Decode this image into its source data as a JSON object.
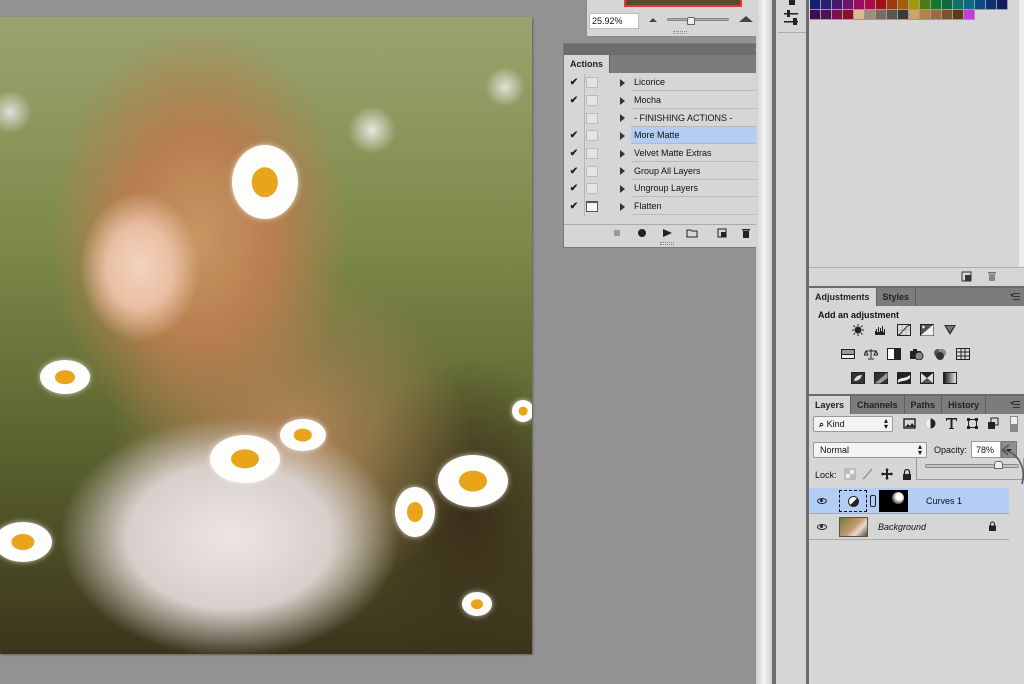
{
  "navigator": {
    "zoom_value": "25.92%",
    "zoom_slider_fraction": 0.45
  },
  "actions_panel": {
    "tab_label": "Actions",
    "items": [
      {
        "name": "Licorice",
        "checked": true,
        "dialog": false,
        "selected": false
      },
      {
        "name": "Mocha",
        "checked": true,
        "dialog": false,
        "selected": false
      },
      {
        "name": "- FINISHING ACTIONS -",
        "checked": false,
        "dialog": false,
        "selected": false
      },
      {
        "name": "More Matte",
        "checked": true,
        "dialog": false,
        "selected": true
      },
      {
        "name": "Velvet Matte Extras",
        "checked": true,
        "dialog": false,
        "selected": false
      },
      {
        "name": "Group All Layers",
        "checked": true,
        "dialog": false,
        "selected": false
      },
      {
        "name": "Ungroup Layers",
        "checked": true,
        "dialog": false,
        "selected": false
      },
      {
        "name": "Flatten",
        "checked": true,
        "dialog": true,
        "selected": false
      }
    ],
    "footer_buttons": [
      "stop-icon",
      "record-icon",
      "play-icon",
      "new-set-folder-icon",
      "new-action-icon",
      "trash-icon"
    ],
    "check_glyph": "✔"
  },
  "swatches": {
    "row1": [
      "#14206e",
      "#2a1c6e",
      "#48176e",
      "#6a146c",
      "#9c0a5f",
      "#b0094a",
      "#a30e19",
      "#9b3b0a",
      "#a35e0a",
      "#a39a0a",
      "#4d7b19",
      "#0f7a2e",
      "#0f6b3e",
      "#0d7164",
      "#0d6a86",
      "#0c4a86",
      "#0e3070",
      "#0e1e62"
    ],
    "row2": [
      "#3b0d54",
      "#560f55",
      "#7b0e4f",
      "#8a0d2a",
      "#d9b990",
      "#a08e7c",
      "#7c6a5e",
      "#5c544f",
      "#3e3a38",
      "#d2a06a",
      "#b68252",
      "#9d6b3e",
      "#7f5328",
      "#5f3a14",
      "#c53bd9"
    ]
  },
  "adjustments_panel": {
    "tabs": [
      "Adjustments",
      "Styles"
    ],
    "active_tab": "Adjustments",
    "heading": "Add an adjustment",
    "row1_icons": [
      "brightness-contrast-icon",
      "levels-icon",
      "curves-icon",
      "exposure-icon",
      "vibrance-icon"
    ],
    "row2_icons": [
      "hue-saturation-icon",
      "color-balance-icon",
      "black-white-icon",
      "photo-filter-icon",
      "channel-mixer-icon",
      "color-lookup-icon"
    ],
    "row3_icons": [
      "invert-icon",
      "posterize-icon",
      "threshold-icon",
      "selective-color-icon",
      "gradient-map-icon"
    ]
  },
  "layers_panel": {
    "tabs": [
      "Layers",
      "Channels",
      "Paths",
      "History"
    ],
    "active_tab": "Layers",
    "filter_kind": "Kind",
    "filter_glyph_search": "⌕",
    "blend_mode": "Normal",
    "opacity_label": "Opacity:",
    "opacity_value": "78%",
    "opacity_slider_fraction": 0.78,
    "lock_label": "Lock:",
    "layers": [
      {
        "name": "Curves 1",
        "type": "adjustment",
        "visible": true,
        "selected": true
      },
      {
        "name": "Background",
        "type": "pixel",
        "visible": true,
        "selected": false,
        "locked": true
      }
    ]
  }
}
